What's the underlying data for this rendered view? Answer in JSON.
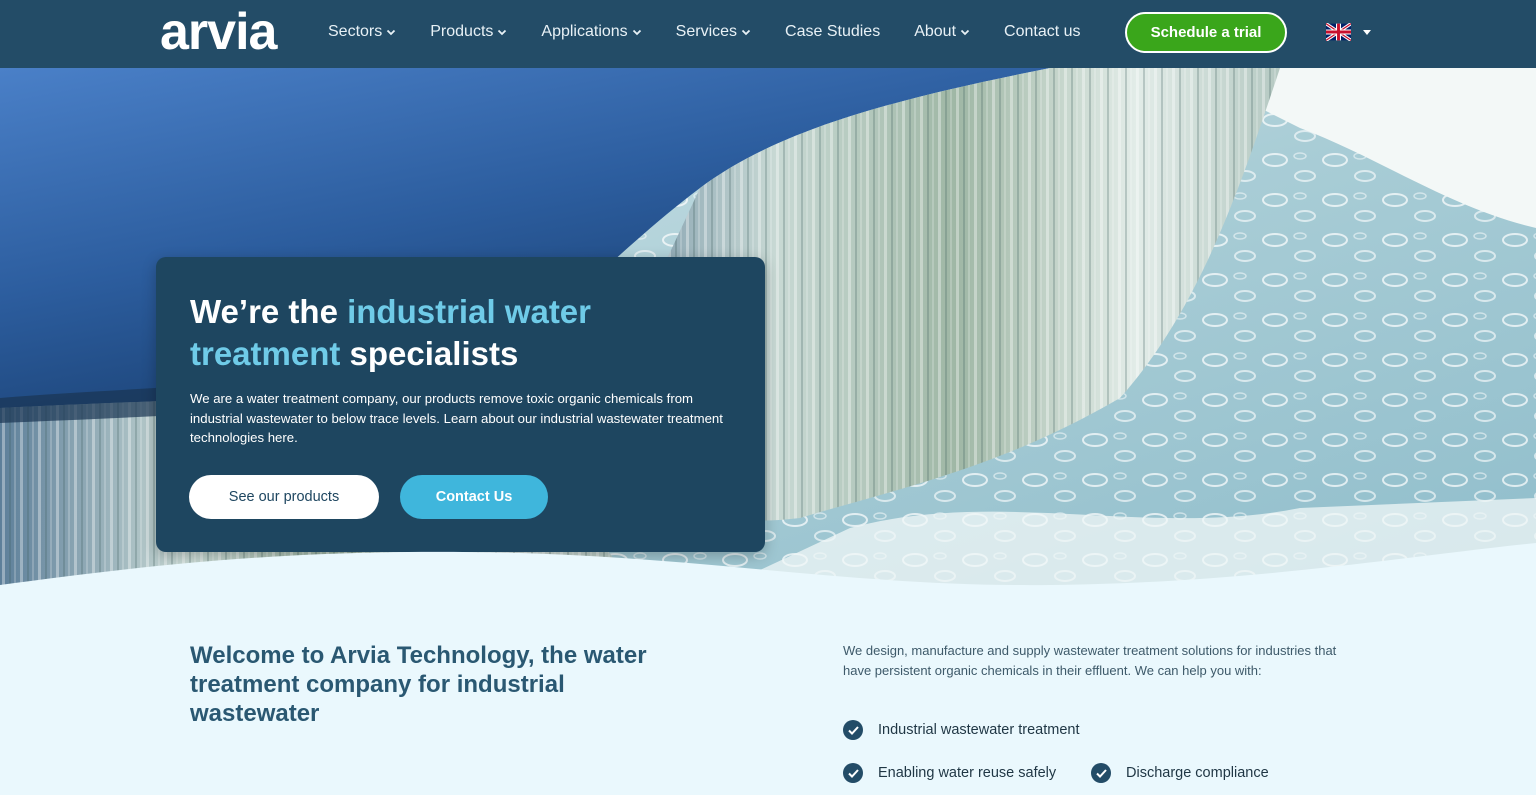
{
  "brand": {
    "logo_text": "arvia"
  },
  "nav": {
    "items": [
      {
        "label": "Sectors",
        "has_dropdown": true
      },
      {
        "label": "Products",
        "has_dropdown": true
      },
      {
        "label": "Applications",
        "has_dropdown": true
      },
      {
        "label": "Services",
        "has_dropdown": true
      },
      {
        "label": "Case Studies",
        "has_dropdown": false
      },
      {
        "label": "About",
        "has_dropdown": true
      },
      {
        "label": "Contact us",
        "has_dropdown": false
      }
    ],
    "cta_label": "Schedule a trial",
    "language_icon": "uk-flag-icon"
  },
  "hero": {
    "title_part1": "We’re the ",
    "title_highlight": "industrial water treatment",
    "title_part2": " specialists",
    "body": "We are a water treatment company, our products remove toxic organic chemicals from industrial wastewater to below trace levels. Learn about our industrial wastewater treatment technologies here.",
    "primary_button": "See our products",
    "secondary_button": "Contact Us"
  },
  "intro": {
    "heading": "Welcome to Arvia Technology, the water treatment company for industrial wastewater",
    "text": "We design, manufacture and supply wastewater treatment solutions for industries that have persistent organic chemicals in their effluent. We can help you with:",
    "checks": [
      "Industrial wastewater treatment",
      "Enabling water reuse safely",
      "Discharge compliance"
    ]
  },
  "colors": {
    "nav_bg": "#234c67",
    "card_bg": "#1e4660",
    "accent_green": "#3aa61b",
    "accent_blue": "#3fb6dc",
    "highlight_text": "#6fcbe8",
    "section_bg": "#eaf8fd"
  }
}
